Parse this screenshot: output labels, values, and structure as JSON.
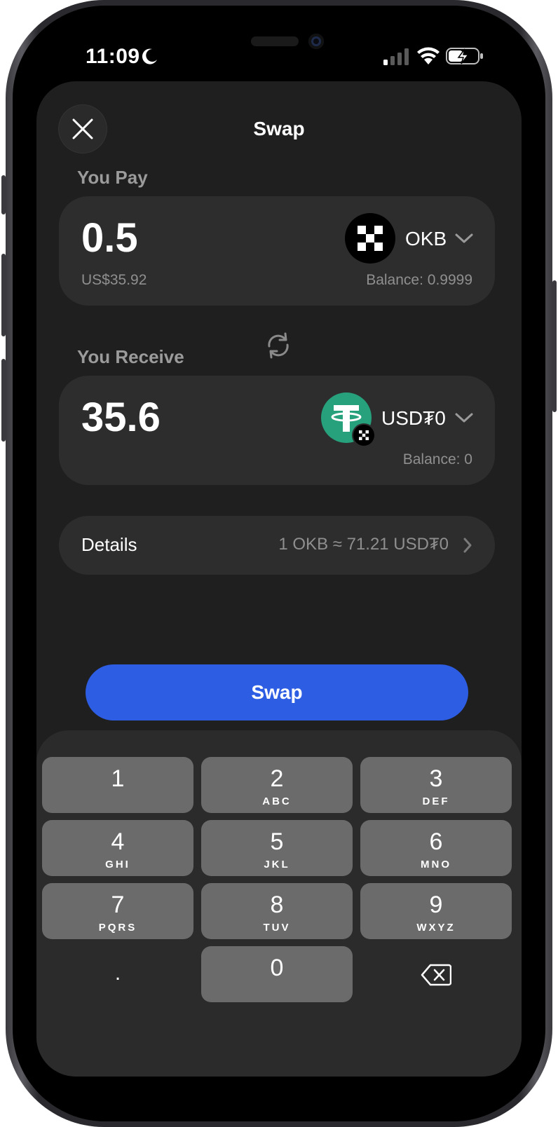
{
  "status_bar": {
    "time": "11:09",
    "icons": [
      "moon-icon",
      "cellular-signal-icon",
      "wifi-icon",
      "battery-charging-icon"
    ]
  },
  "header": {
    "title": "Swap",
    "close_icon": "close-icon"
  },
  "pay": {
    "label": "You Pay",
    "amount": "0.5",
    "fiat_value": "US$35.92",
    "token": "OKB",
    "balance": "Balance: 0.9999"
  },
  "swap_direction_icon": "swap-arrows-icon",
  "receive": {
    "label": "You Receive",
    "amount": "35.6",
    "token": "USD₮0",
    "balance": "Balance: 0"
  },
  "details": {
    "label": "Details",
    "rate": "1 OKB ≈ 71.21 USD₮0"
  },
  "swap_button": {
    "label": "Swap"
  },
  "keypad": {
    "keys": [
      {
        "digit": "1",
        "letters": ""
      },
      {
        "digit": "2",
        "letters": "ABC"
      },
      {
        "digit": "3",
        "letters": "DEF"
      },
      {
        "digit": "4",
        "letters": "GHI"
      },
      {
        "digit": "5",
        "letters": "JKL"
      },
      {
        "digit": "6",
        "letters": "MNO"
      },
      {
        "digit": "7",
        "letters": "PQRS"
      },
      {
        "digit": "8",
        "letters": "TUV"
      },
      {
        "digit": "9",
        "letters": "WXYZ"
      },
      {
        "digit": ".",
        "letters": ""
      },
      {
        "digit": "0",
        "letters": ""
      },
      {
        "digit": "",
        "letters": "",
        "icon": "backspace-icon"
      }
    ]
  },
  "colors": {
    "accent": "#2d5de3",
    "sheet_bg": "#1f1f1f",
    "card_bg": "#2d2d2d",
    "key_bg": "#6b6b6b",
    "tether_green": "#26a17b"
  }
}
